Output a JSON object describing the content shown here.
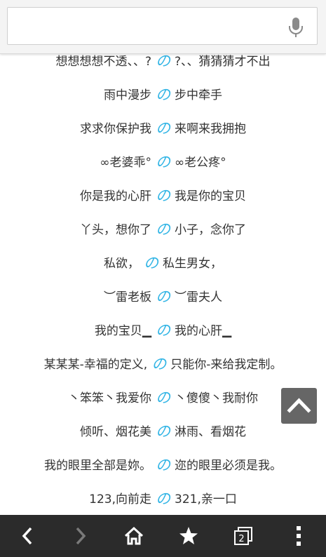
{
  "search": {
    "value": "",
    "placeholder": ""
  },
  "icons": {
    "mic": "microphone-icon",
    "scroll_top": "chevron-up-icon",
    "back": "chevron-left-icon",
    "forward": "chevron-right-icon",
    "home": "home-icon",
    "bookmark": "star-icon",
    "tabs": "tabs-icon",
    "menu": "more-vertical-icon"
  },
  "colors": {
    "accent": "#33b5e5",
    "text": "#333333",
    "bottombar": "#2b2b2b"
  },
  "separator": "の",
  "tab_count": "2",
  "pairs": [
    {
      "left": "想想想想不透、、?",
      "right": "?、、猜猜猜才不出"
    },
    {
      "left": "雨中漫步",
      "right": "步中牵手"
    },
    {
      "left": "求求你保护我",
      "right": "来啊来我拥抱"
    },
    {
      "left": "∞老婆乖°",
      "right": "∞老公疼°"
    },
    {
      "left": "你是我的心肝",
      "right": "我是你的宝贝"
    },
    {
      "left": "丫头，想你了",
      "right": "小子，念你了"
    },
    {
      "left": "私欲，",
      "right": "私生男女，"
    },
    {
      "left": "︶雷老板",
      "right": "︶雷夫人"
    },
    {
      "left": "我的宝贝▁",
      "right": "我的心肝▁"
    },
    {
      "left": "某某某-幸福的定义,",
      "right": "只能你-来给我定制。"
    },
    {
      "left": "丶笨笨丶我爱你",
      "right": "丶傻傻丶我耐你"
    },
    {
      "left": "倾听、烟花美",
      "right": "淋雨、看烟花"
    },
    {
      "left": "我的眼里全部是妳。",
      "right": "迩的眼里必须是我。"
    },
    {
      "left": "123,向前走",
      "right": "321,亲一口"
    }
  ]
}
